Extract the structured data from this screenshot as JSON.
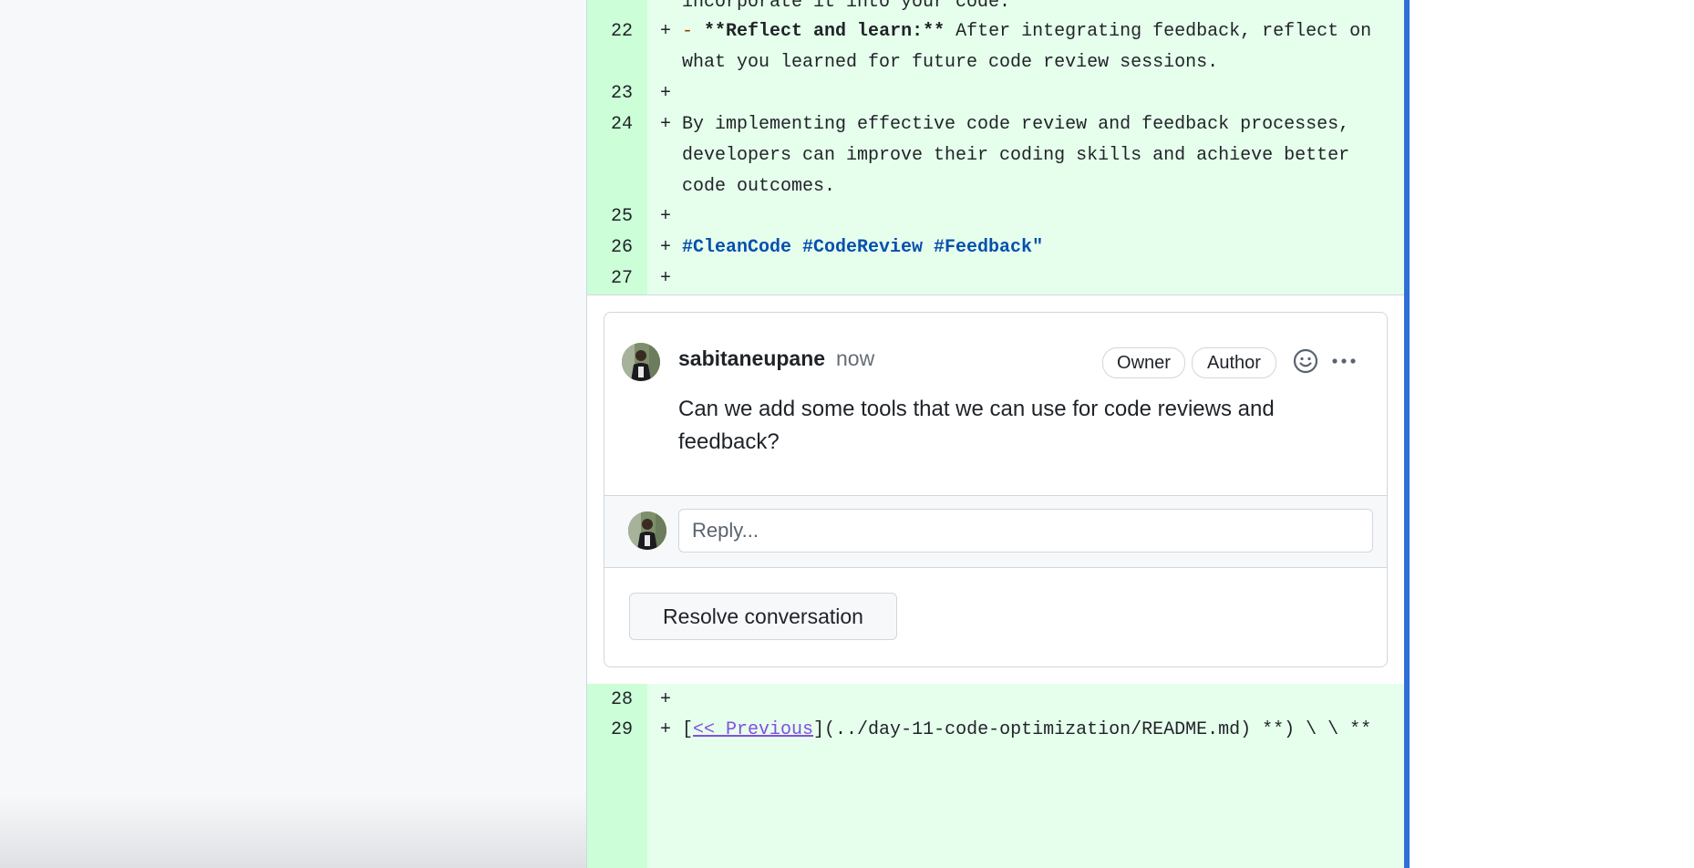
{
  "diff_top": {
    "lines": [
      {
        "num": "",
        "prefix": "",
        "text": "incorporate it into your code."
      },
      {
        "num": "22",
        "prefix": "+",
        "dash": "-",
        "bold": "**Reflect and learn:**",
        "text": " After integrating feedback, reflect on what you learned for future code review sessions."
      },
      {
        "num": "23",
        "prefix": "+",
        "text": ""
      },
      {
        "num": "24",
        "prefix": "+",
        "text": "By implementing effective code review and feedback processes, developers can improve their coding skills and achieve better code outcomes."
      },
      {
        "num": "25",
        "prefix": "+",
        "text": ""
      },
      {
        "num": "26",
        "prefix": "+",
        "tags": "#CleanCode #CodeReview #Feedback",
        "quote": "\""
      },
      {
        "num": "27",
        "prefix": "+",
        "text": ""
      }
    ]
  },
  "comment": {
    "author": "sabitaneupane",
    "timestamp": "now",
    "badges": {
      "owner": "Owner",
      "author": "Author"
    },
    "body": "Can we add some tools that we can use for code reviews and feedback?",
    "reply_placeholder": "Reply...",
    "resolve_label": "Resolve conversation",
    "icons": {
      "emoji": "smiley-icon",
      "more": "kebab-horizontal-icon"
    }
  },
  "diff_bottom": {
    "lines": [
      {
        "num": "28",
        "prefix": "+",
        "text": ""
      },
      {
        "num": "29",
        "prefix": "+",
        "link": "<< Previous",
        "rest": "](../day-11-code-optimization/README.md) **) \\ \\ **"
      }
    ]
  },
  "colors": {
    "added_bg": "#e6ffec",
    "added_gutter": "#ccffd8",
    "accent": "#2f6fd6"
  }
}
